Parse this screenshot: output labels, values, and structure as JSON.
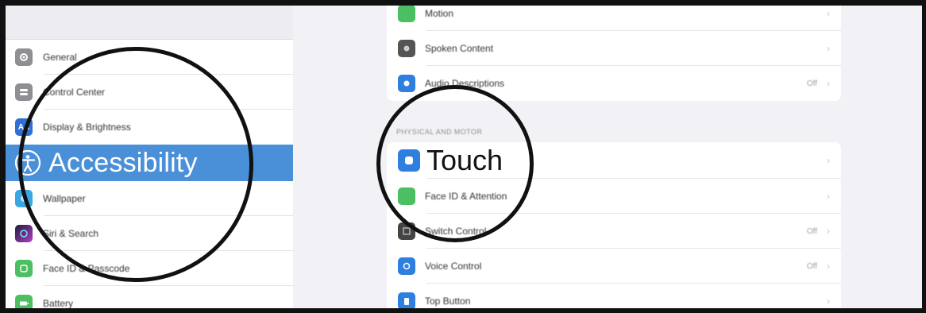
{
  "sidebar": {
    "items": [
      {
        "label": "General",
        "icon": "gear-icon",
        "color": "#8e8e93"
      },
      {
        "label": "Control Center",
        "icon": "switches-icon",
        "color": "#8e8e93"
      },
      {
        "label": "Display & Brightness",
        "icon": "text-size-icon",
        "color": "#2f6fd6"
      },
      {
        "label": "Accessibility",
        "icon": "accessibility-icon",
        "color": "#4a90d9",
        "selected": true
      },
      {
        "label": "Wallpaper",
        "icon": "wallpaper-icon",
        "color": "#39a7e3"
      },
      {
        "label": "Siri & Search",
        "icon": "siri-icon",
        "color": "#3a2a6a"
      },
      {
        "label": "Face ID & Passcode",
        "icon": "face-id-icon",
        "color": "#4cbf62"
      },
      {
        "label": "Battery",
        "icon": "battery-icon",
        "color": "#4cbf62"
      }
    ]
  },
  "main": {
    "top_group": [
      {
        "label": "Motion",
        "icon": "motion-icon",
        "color": "#4cbf62",
        "value": ""
      },
      {
        "label": "Spoken Content",
        "icon": "speech-icon",
        "color": "#555555",
        "value": ""
      },
      {
        "label": "Audio Descriptions",
        "icon": "audio-description-icon",
        "color": "#2f7fe0",
        "value": "Off"
      }
    ],
    "section_header": "Physical and Motor",
    "motor_group": [
      {
        "label": "Touch",
        "icon": "touch-icon",
        "color": "#2f7fe0",
        "value": ""
      },
      {
        "label": "Face ID & Attention",
        "icon": "face-id-icon",
        "color": "#4cbf62",
        "value": ""
      },
      {
        "label": "Switch Control",
        "icon": "switch-control-icon",
        "color": "#444444",
        "value": "Off"
      },
      {
        "label": "Voice Control",
        "icon": "voice-control-icon",
        "color": "#2f7fe0",
        "value": "Off"
      },
      {
        "label": "Top Button",
        "icon": "top-button-icon",
        "color": "#2f7fe0",
        "value": ""
      }
    ]
  }
}
